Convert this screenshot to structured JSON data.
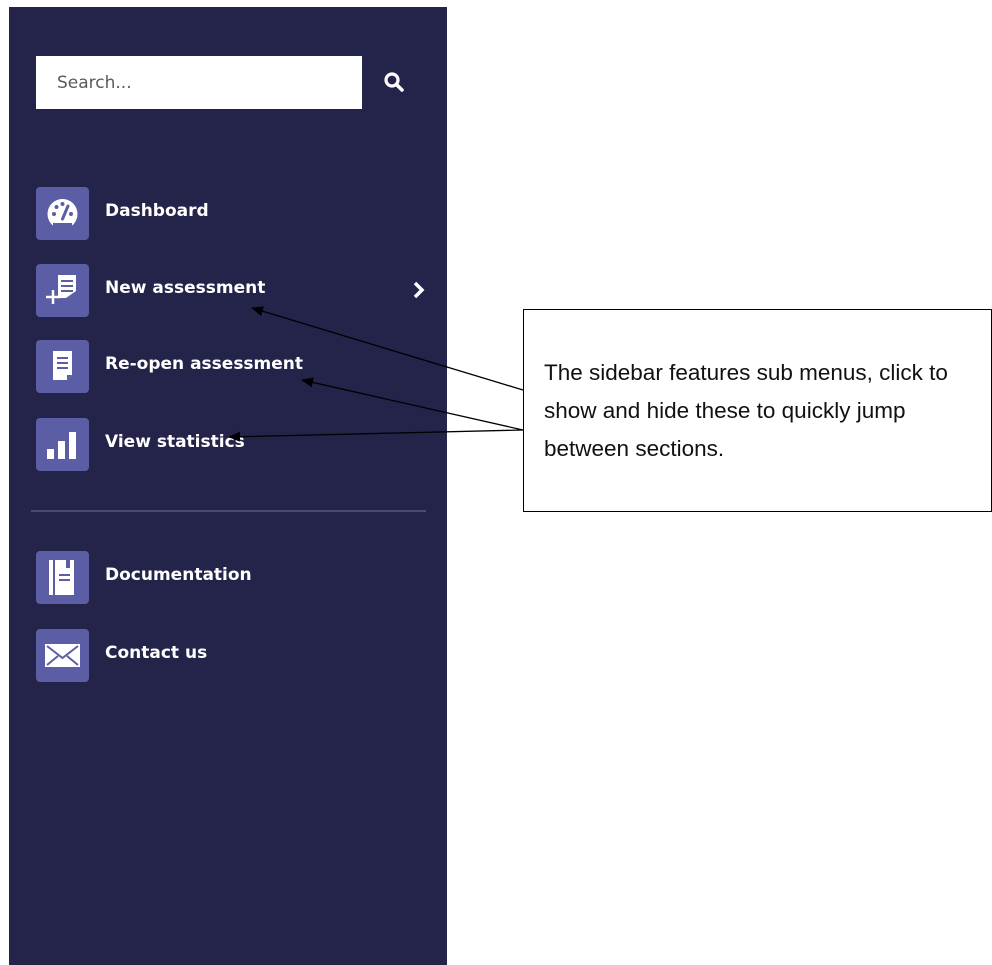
{
  "sidebar": {
    "search": {
      "placeholder": "Search...",
      "icon": "search-icon"
    },
    "nav_items": [
      {
        "label": "Dashboard",
        "icon": "dashboard-gauge-icon"
      },
      {
        "label": "New assessment",
        "icon": "new-document-icon",
        "has_submenu": true
      },
      {
        "label": "Re-open assessment",
        "icon": "document-icon"
      },
      {
        "label": "View statistics",
        "icon": "bar-chart-icon"
      }
    ],
    "secondary_items": [
      {
        "label": "Documentation",
        "icon": "book-icon"
      },
      {
        "label": "Contact us",
        "icon": "envelope-icon"
      }
    ],
    "colors": {
      "background": "#24234a",
      "icon_tile": "#5b5ea4",
      "text": "#ffffff"
    }
  },
  "callout": {
    "text": "The sidebar features sub menus, click to show and hide these to quickly jump between sections."
  }
}
